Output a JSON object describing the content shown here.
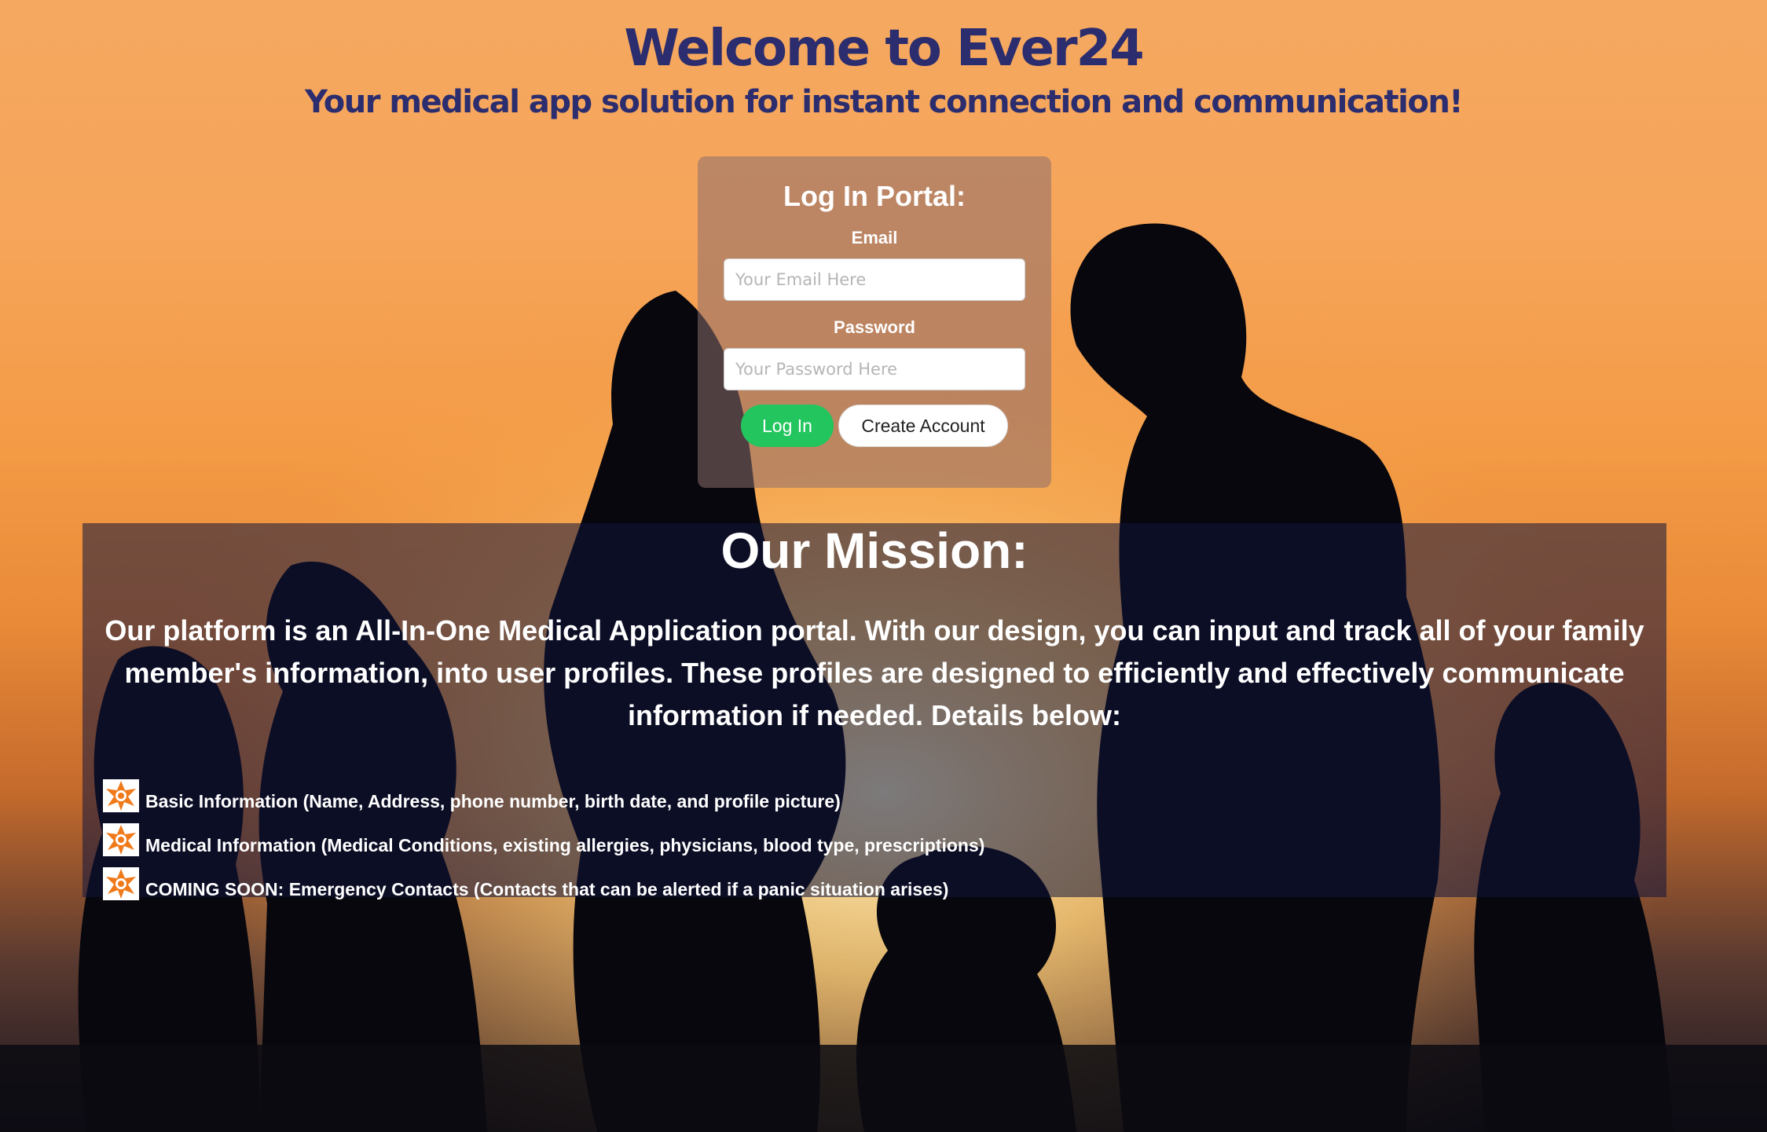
{
  "header": {
    "title": "Welcome to Ever24",
    "subtitle": "Your medical app solution for instant connection and communication!"
  },
  "login": {
    "title": "Log In Portal:",
    "email_label": "Email",
    "email_placeholder": "Your Email Here",
    "password_label": "Password",
    "password_placeholder": "Your Password Here",
    "login_button": "Log In",
    "create_button": "Create Account"
  },
  "mission": {
    "title": "Our Mission:",
    "text": "Our platform is an All-In-One Medical Application portal. With our design, you can input and track all of your family member's information, into user profiles. These profiles are designed to efficiently and effectively communicate information if needed. Details below:",
    "features": [
      "Basic Information (Name, Address, phone number, birth date, and profile picture)",
      "Medical Information (Medical Conditions, existing allergies, physicians, blood type, prescriptions)",
      "COMING SOON: Emergency Contacts (Contacts that can be alerted if a panic situation arises)"
    ]
  },
  "colors": {
    "title": "#2b2d6e",
    "login_button": "#22c55e",
    "sky_top": "#f5a860",
    "sky_bottom": "#1b1620"
  },
  "icons": {
    "feature_bullet": "orange-star-badge-icon"
  }
}
